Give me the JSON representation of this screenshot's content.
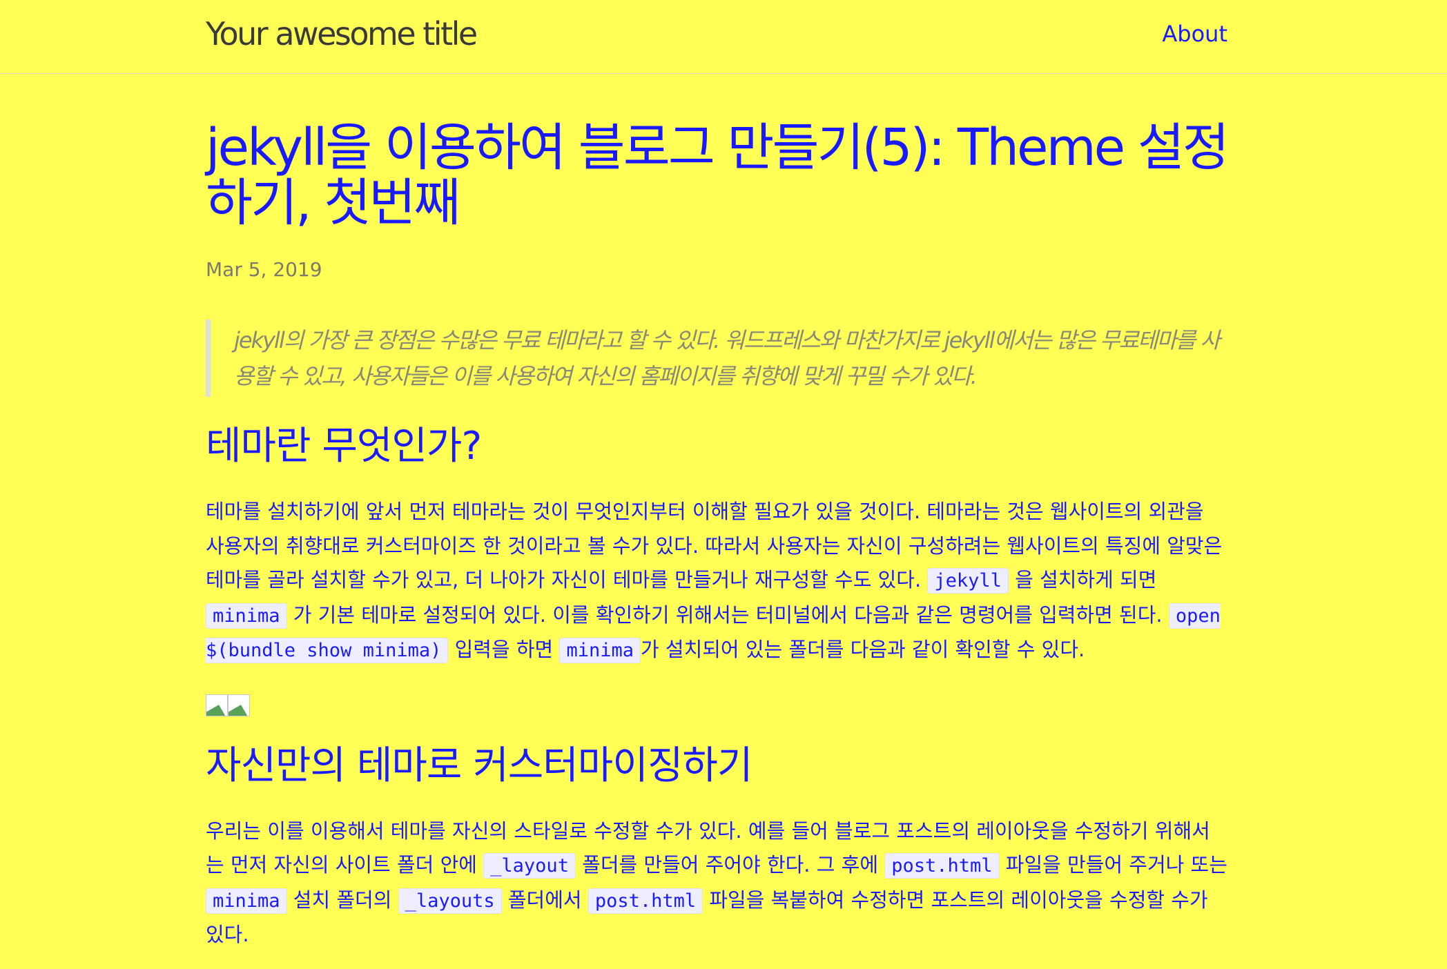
{
  "header": {
    "site_title": "Your awesome title",
    "nav_about": "About"
  },
  "post": {
    "title": "jekyll을 이용하여 블로그 만들기(5): Theme 설정하기, 첫번째",
    "date": "Mar 5, 2019",
    "intro_quote": "jekyll의 가장 큰 장점은 수많은 무료 테마라고 할 수 있다. 워드프레스와 마찬가지로 jekyll에서는 많은 무료테마를 사용할 수 있고, 사용자들은 이를 사용하여 자신의 홈페이지를 취향에 맞게 꾸밀 수가 있다.",
    "section1": {
      "heading": "테마란 무엇인가?",
      "p1_text1": "테마를 설치하기에 앞서 먼저 테마라는 것이 무엇인지부터 이해할 필요가 있을 것이다. 테마라는 것은 웹사이트의 외관을 사용자의 취향대로 커스터마이즈 한 것이라고 볼 수가 있다. 따라서 사용자는 자신이 구성하려는 웹사이트의 특징에 알맞은 테마를 골라 설치할 수가 있고, 더 나아가 자신이 테마를 만들거나 재구성할 수도 있다. ",
      "p1_code1": "jekyll",
      "p1_text2": " 을 설치하게 되면 ",
      "p1_code2": "minima",
      "p1_text3": " 가 기본 테마로 설정되어 있다. 이를 확인하기 위해서는 터미널에서 다음과 같은 명령어를 입력하면 된다. ",
      "p1_code3": "open $(bundle show minima)",
      "p1_text4": " 입력을 하면 ",
      "p1_code4": "minima",
      "p1_text5": "가 설치되어 있는 폴더를 다음과 같이 확인할 수 있다."
    },
    "section2": {
      "heading": "자신만의 테마로 커스터마이징하기",
      "p1_text1": "우리는 이를 이용해서 테마를 자신의 스타일로 수정할 수가 있다. 예를 들어 블로그 포스트의 레이아웃을 수정하기 위해서는 먼저 자신의 사이트 폴더 안에 ",
      "p1_code1": "_layout",
      "p1_text2": " 폴더를 만들어 주어야 한다. 그 후에 ",
      "p1_code2": "post.html",
      "p1_text3": " 파일을 만들어 주거나 또는 ",
      "p1_code3": "minima",
      "p1_text4": " 설치 폴더의 ",
      "p1_code4": "_layouts",
      "p1_text5": " 폴더에서 ",
      "p1_code5": "post.html",
      "p1_text6": " 파일을 복붙하여 수정하면 포스트의 레이아웃을 수정할 수가 있다."
    }
  }
}
